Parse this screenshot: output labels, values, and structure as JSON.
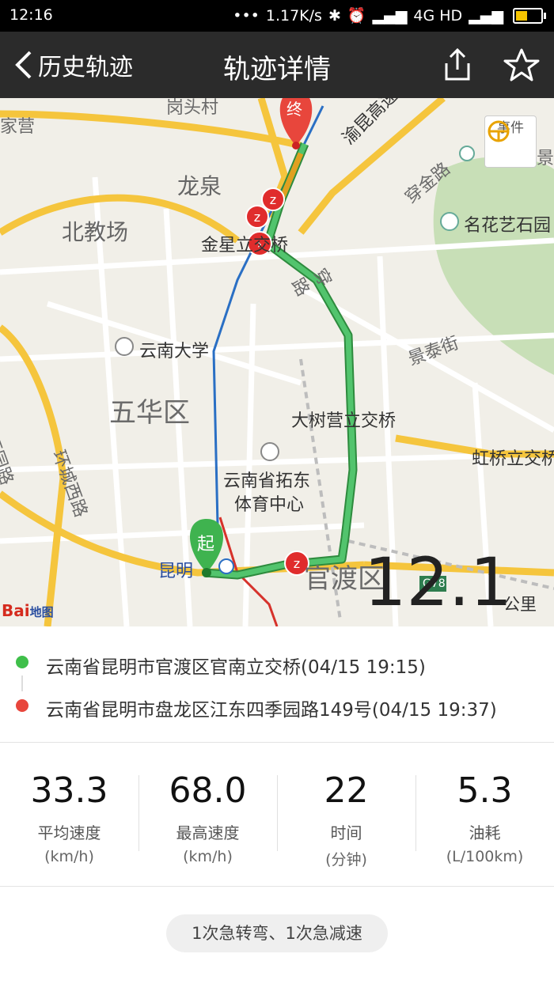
{
  "status_bar": {
    "time": "12:16",
    "net_speed": "1.17K/s",
    "network": "4G HD"
  },
  "header": {
    "back_label": "历史轨迹",
    "title": "轨迹详情"
  },
  "map": {
    "labels": {
      "longquan": "龙泉",
      "beijiaochang": "北教场",
      "jinxing": "金星立交桥",
      "yunnan_univ": "云南大学",
      "wuhua": "五华区",
      "dashuying": "大树营立交桥",
      "tuodong": "云南省拓东",
      "tuodong2": "体育中心",
      "guandu": "官渡区",
      "kunming": "昆明",
      "yukun": "渝昆高速",
      "mingghua": "名花艺石园",
      "hongqiao": "虹桥立交桥",
      "jingtai": "景泰街",
      "chuanjin": "穿金路",
      "gangtou": "岗头村",
      "jiaying": "家营",
      "xiyuan": "西园路",
      "huancheng": "环城西路",
      "g78": "G78",
      "chuan": "穿",
      "lu": "路",
      "jing": "景"
    },
    "start_marker": "起",
    "end_marker": "终",
    "event_button": "事件",
    "logo_main": "Bai",
    "logo_sub": "地图"
  },
  "distance": {
    "value": "12.1",
    "unit": "公里"
  },
  "route": {
    "start": "云南省昆明市官渡区官南立交桥(04/15 19:15)",
    "end": "云南省昆明市盘龙区江东四季园路149号(04/15 19:37)",
    "start_color": "#3fbf4a",
    "end_color": "#e8463c"
  },
  "stats": [
    {
      "value": "33.3",
      "label": "平均速度",
      "unit": "(km/h)"
    },
    {
      "value": "68.0",
      "label": "最高速度",
      "unit": "(km/h)"
    },
    {
      "value": "22",
      "label": "时间",
      "unit": "(分钟)"
    },
    {
      "value": "5.3",
      "label": "油耗",
      "unit": "(L/100km)"
    }
  ],
  "warnings": "1次急转弯、1次急减速"
}
